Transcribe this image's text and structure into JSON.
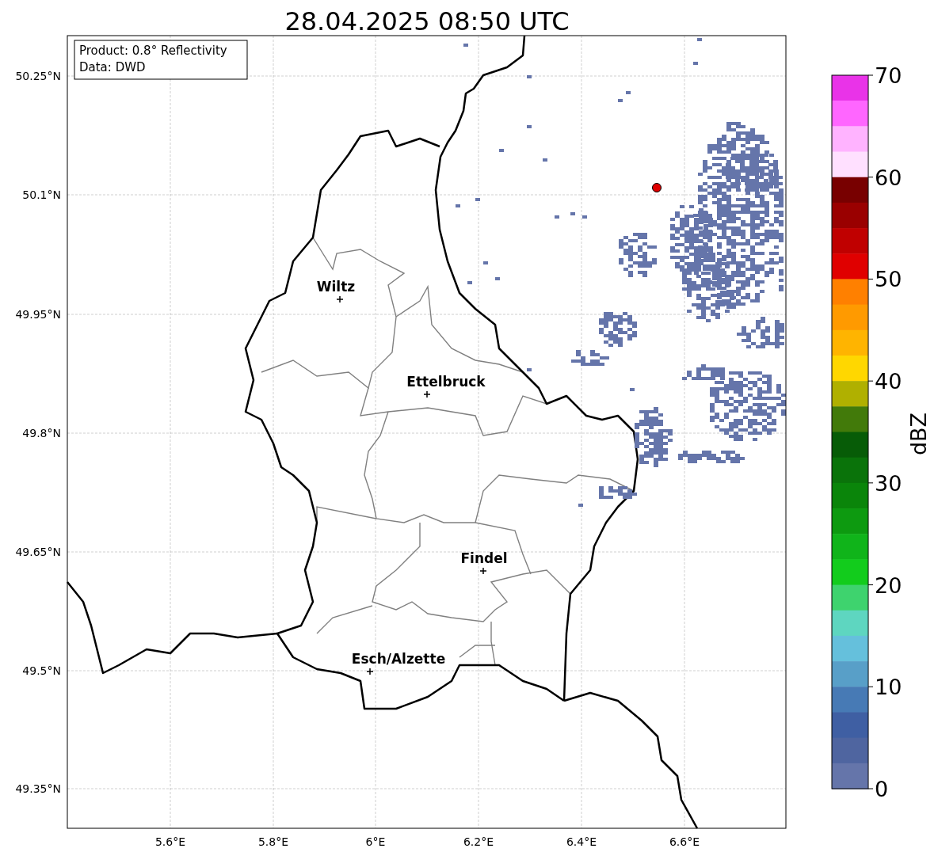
{
  "title": "28.04.2025 08:50 UTC",
  "legend": {
    "lines": [
      "Product: 0.8° Reflectivity",
      "Data: DWD"
    ]
  },
  "map": {
    "lat_labels": [
      "50.25°N",
      "50.1°N",
      "49.95°N",
      "49.8°N",
      "49.65°N",
      "49.5°N",
      "49.35°N"
    ],
    "lon_labels": [
      "5.6°E",
      "5.8°E",
      "6°E",
      "6.2°E",
      "6.4°E",
      "6.6°E"
    ],
    "cities": [
      {
        "name": "Wiltz"
      },
      {
        "name": "Ettelbruck"
      },
      {
        "name": "Findel"
      },
      {
        "name": "Esch/Alzette"
      }
    ]
  },
  "colorbar": {
    "label": "dBZ",
    "ticks": [
      "70",
      "60",
      "50",
      "40",
      "30",
      "20",
      "10",
      "0"
    ],
    "bins": [
      {
        "color": "#e933e8"
      },
      {
        "color": "#ff66ff"
      },
      {
        "color": "#ffb3ff"
      },
      {
        "color": "#ffe0ff"
      },
      {
        "color": "#780000"
      },
      {
        "color": "#9a0000"
      },
      {
        "color": "#c00000"
      },
      {
        "color": "#e00000"
      },
      {
        "color": "#ff8000"
      },
      {
        "color": "#ff9a00"
      },
      {
        "color": "#ffb400"
      },
      {
        "color": "#ffd700"
      },
      {
        "color": "#b0b000"
      },
      {
        "color": "#427a0a"
      },
      {
        "color": "#075c07"
      },
      {
        "color": "#0a730a"
      },
      {
        "color": "#0a850a"
      },
      {
        "color": "#0d9a10"
      },
      {
        "color": "#10b41a"
      },
      {
        "color": "#12cc1c"
      },
      {
        "color": "#3ed36e"
      },
      {
        "color": "#5ed6c0"
      },
      {
        "color": "#65c0dc"
      },
      {
        "color": "#589fc8"
      },
      {
        "color": "#477ab5"
      },
      {
        "color": "#3f5fa3"
      },
      {
        "color": "#4f65a0"
      },
      {
        "color": "#6575aa"
      }
    ]
  }
}
